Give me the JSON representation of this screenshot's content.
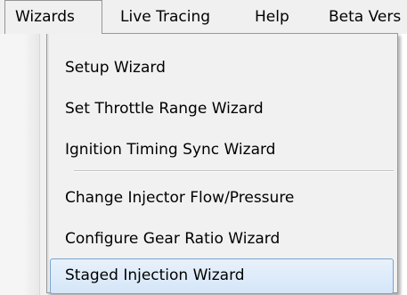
{
  "menubar": {
    "items": [
      {
        "label": "Wizards",
        "open": true
      },
      {
        "label": "Live Tracing"
      },
      {
        "label": "Help"
      },
      {
        "label": "Beta Vers"
      }
    ]
  },
  "menu": {
    "group1": [
      {
        "label": "Setup Wizard"
      },
      {
        "label": "Set Throttle Range Wizard"
      },
      {
        "label": "Ignition Timing Sync Wizard"
      }
    ],
    "group2": [
      {
        "label": "Change Injector Flow/Pressure"
      },
      {
        "label": "Configure Gear Ratio Wizard"
      },
      {
        "label": "Staged Injection Wizard",
        "highlighted": true
      }
    ]
  },
  "colors": {
    "menu_background": "#f1f1f1",
    "highlight_border": "#7da2ce",
    "highlight_fill": "#dde9f8"
  }
}
